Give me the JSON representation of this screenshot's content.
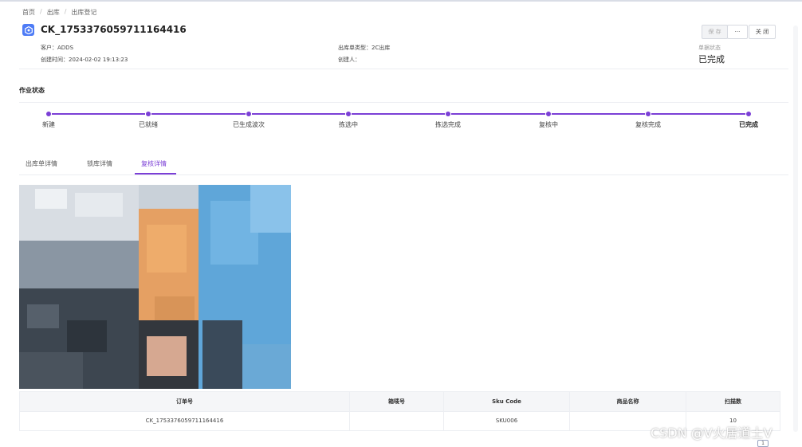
{
  "breadcrumb": [
    "首页",
    "出库",
    "出库登记"
  ],
  "document": {
    "title": "CK_1753376059711164416",
    "customer": "客户：ADDS",
    "type": "出库单类型：2C出库",
    "created_time": "创建时间：2024-02-02 19:13:23",
    "creator": "创建人：",
    "state_label": "单据状态",
    "state_value": "已完成"
  },
  "toolbar": {
    "save_label": "保 存",
    "more_label": "···",
    "close_label": "关 闭"
  },
  "workflow": {
    "title": "作业状态",
    "steps": [
      "新建",
      "已就绪",
      "已生成波次",
      "拣选中",
      "拣选完成",
      "复核中",
      "复核完成",
      "已完成"
    ],
    "current": "已完成"
  },
  "tabs": [
    "出库单详情",
    "锁库详情",
    "复核详情"
  ],
  "active_tab": "复核详情",
  "table": {
    "headers": [
      "订单号",
      "箱唛号",
      "Sku Code",
      "商品名称",
      "扫描数"
    ],
    "rows": [
      [
        "CK_1753376059711164416",
        "",
        "SKU006",
        "",
        "10"
      ]
    ]
  },
  "pager": {
    "page": "1"
  },
  "watermark": "CSDN @V火居道士V",
  "colors": {
    "accent": "#7b3fd6",
    "icon_blue": "#4e7cf6"
  }
}
